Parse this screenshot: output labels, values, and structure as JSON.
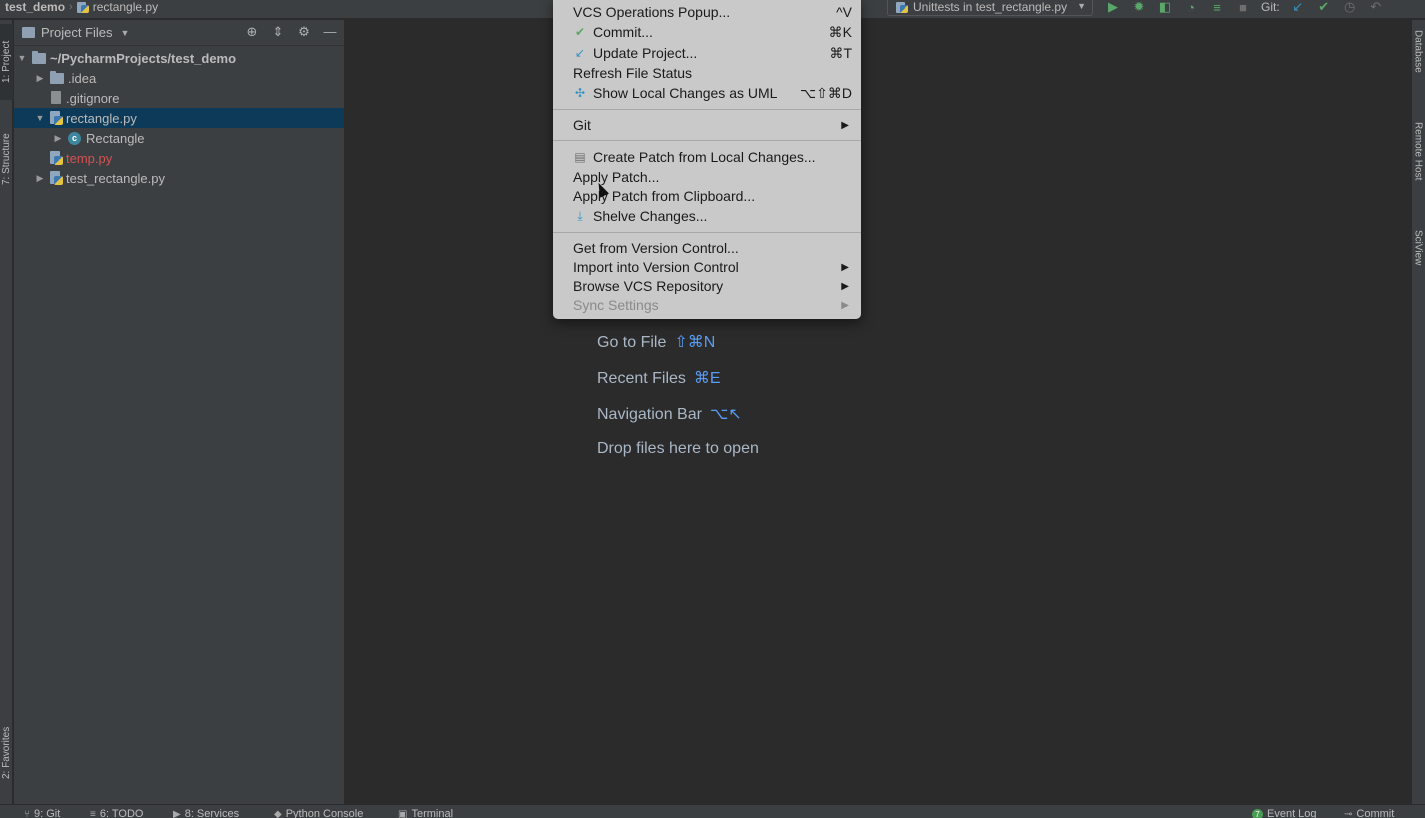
{
  "breadcrumb": {
    "project": "test_demo",
    "file": "rectangle.py"
  },
  "toolbar": {
    "run_config": "Unittests in test_rectangle.py",
    "git_label": "Git:"
  },
  "left_tabs": {
    "project": "1: Project",
    "structure": "7: Structure",
    "favorites": "2: Favorites"
  },
  "right_tabs": {
    "database": "Database",
    "remote_host": "Remote Host",
    "sciview": "SciView"
  },
  "project_panel": {
    "title": "Project Files",
    "tree": [
      {
        "label": "~/PycharmProjects/test_demo",
        "type": "root"
      },
      {
        "label": ".idea",
        "type": "folder"
      },
      {
        "label": ".gitignore",
        "type": "file"
      },
      {
        "label": "rectangle.py",
        "type": "py"
      },
      {
        "label": "Rectangle",
        "type": "class"
      },
      {
        "label": "temp.py",
        "type": "py-untracked"
      },
      {
        "label": "test_rectangle.py",
        "type": "py"
      }
    ]
  },
  "vcs_menu": {
    "items": [
      {
        "label": "VCS Operations Popup...",
        "shortcut": "^V"
      },
      {
        "label": "Commit...",
        "shortcut": "⌘K",
        "icon": "check-icon"
      },
      {
        "label": "Update Project...",
        "shortcut": "⌘T",
        "icon": "update-arrow-icon"
      },
      {
        "label": "Refresh File Status",
        "shortcut": ""
      },
      {
        "label": "Show Local Changes as UML",
        "shortcut": "⌥⇧⌘D",
        "icon": "uml-icon"
      },
      {
        "label": "Git",
        "submenu": true
      },
      {
        "label": "Create Patch from Local Changes...",
        "icon": "patch-icon"
      },
      {
        "label": "Apply Patch..."
      },
      {
        "label": "Apply Patch from Clipboard..."
      },
      {
        "label": "Shelve Changes...",
        "icon": "shelve-icon"
      },
      {
        "label": "Get from Version Control..."
      },
      {
        "label": "Import into Version Control",
        "submenu": true
      },
      {
        "label": "Browse VCS Repository",
        "submenu": true
      },
      {
        "label": "Sync Settings",
        "submenu": true,
        "disabled": true
      }
    ]
  },
  "editor_hints": [
    {
      "label": "Go to File",
      "shortcut": "⇧⌘N"
    },
    {
      "label": "Recent Files",
      "shortcut": "⌘E"
    },
    {
      "label": "Navigation Bar",
      "shortcut": "⌥↖"
    },
    {
      "label": "Drop files here to open",
      "shortcut": ""
    }
  ],
  "status_bar": {
    "git": "9: Git",
    "todo": "6: TODO",
    "services": "8: Services",
    "python_console": "Python Console",
    "terminal": "Terminal",
    "event_log": "Event Log",
    "event_count": "7",
    "commit": "Commit"
  },
  "colors": {
    "selection": "#0d3a58",
    "accent": "#589df6",
    "untracked": "#d25252",
    "menu_bg": "#c9c9c9"
  }
}
